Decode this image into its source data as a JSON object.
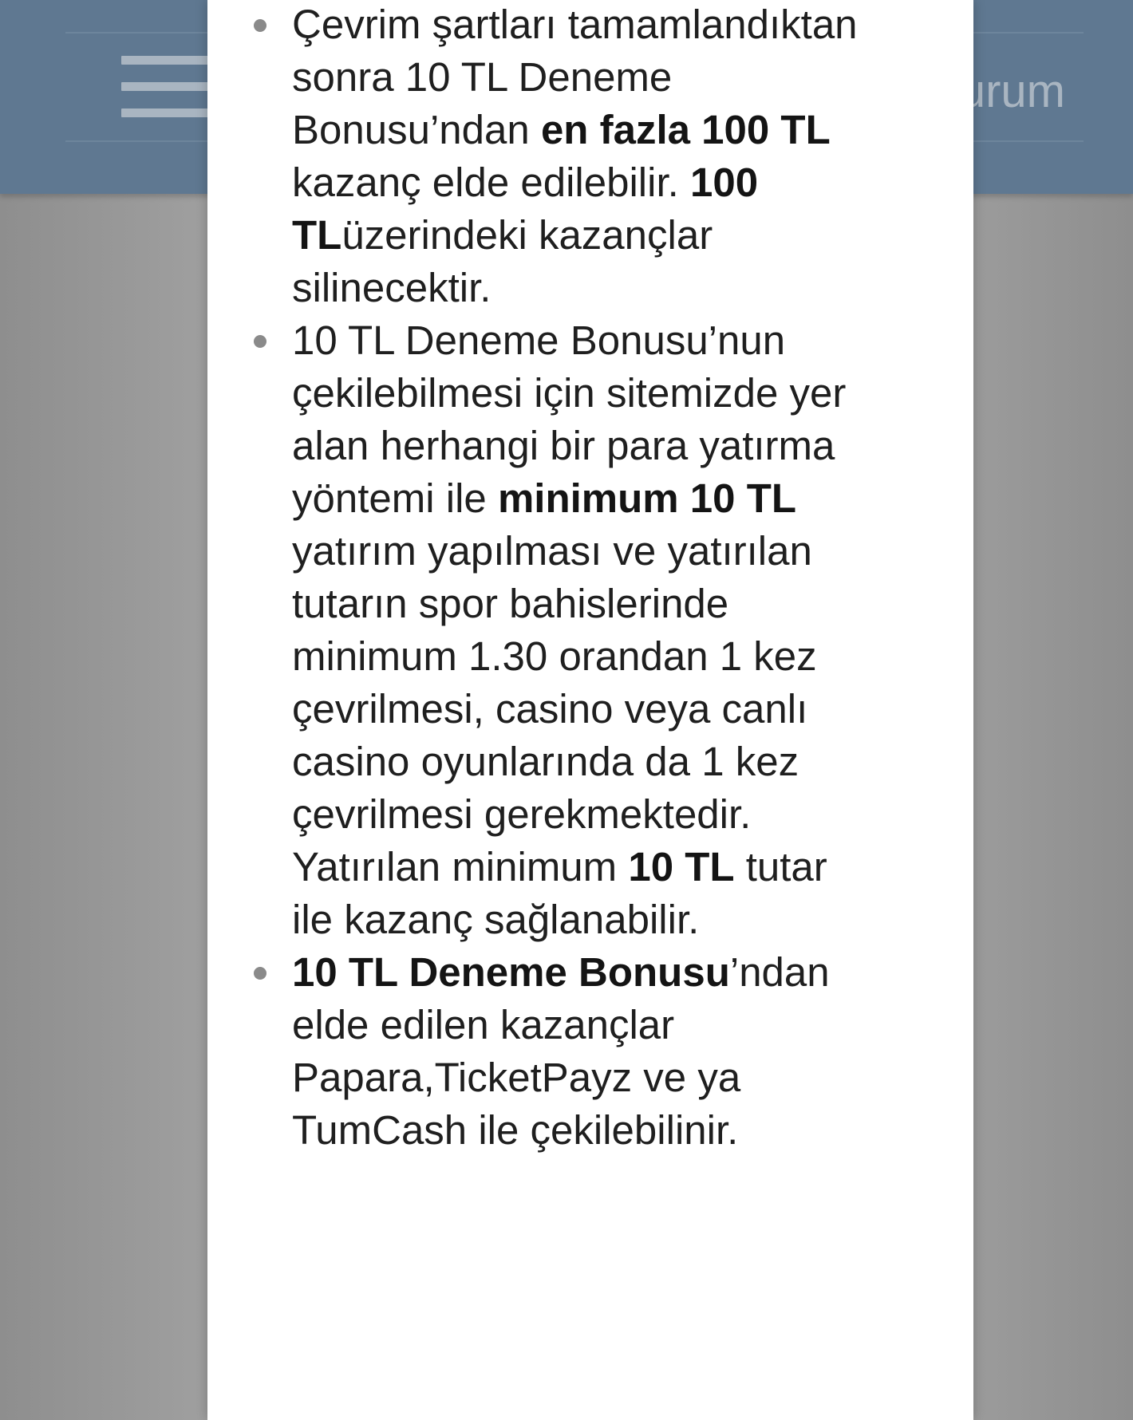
{
  "header": {
    "menu_icon": "hamburger-menu-icon",
    "partial_label": "urum"
  },
  "terms": [
    {
      "segments": [
        {
          "text": "Çevrim şartları tamamlandıktan sonra 10 TL Deneme Bonusu’ndan ",
          "bold": false
        },
        {
          "text": "en fazla 100 TL",
          "bold": true
        },
        {
          "text": " kazanç elde edilebilir. ",
          "bold": false
        },
        {
          "text": "100 TL",
          "bold": true
        },
        {
          "text": "üzerindeki kazançlar silinecektir.",
          "bold": false
        }
      ]
    },
    {
      "segments": [
        {
          "text": "10 TL Deneme Bonusu’nun çekilebilmesi için sitemizde yer alan herhangi bir para yatırma yöntemi  ile ",
          "bold": false
        },
        {
          "text": "minimum 10 TL",
          "bold": true
        },
        {
          "text": " yatırım yapılması ve yatırılan tutarın spor bahislerinde minimum 1.30 orandan 1 kez çevrilmesi, casino veya canlı casino oyunlarında da 1 kez çevrilmesi gerekmektedir. Yatırılan minimum ",
          "bold": false
        },
        {
          "text": "10 TL",
          "bold": true
        },
        {
          "text": " tutar ile kazanç sağlanabilir.",
          "bold": false
        }
      ]
    },
    {
      "segments": [
        {
          "text": "10 TL Deneme Bonusu",
          "bold": true
        },
        {
          "text": "’ndan elde edilen kazançlar Papara,TicketPayz ve ya TumCash ile çekilebilinir.",
          "bold": false
        }
      ]
    }
  ],
  "colors": {
    "header_bg": "#5f7891",
    "overlay_bg": "#a3a3a3",
    "modal_bg": "#ffffff",
    "text": "#1f1f1f",
    "bullet": "#8a8a8a"
  }
}
